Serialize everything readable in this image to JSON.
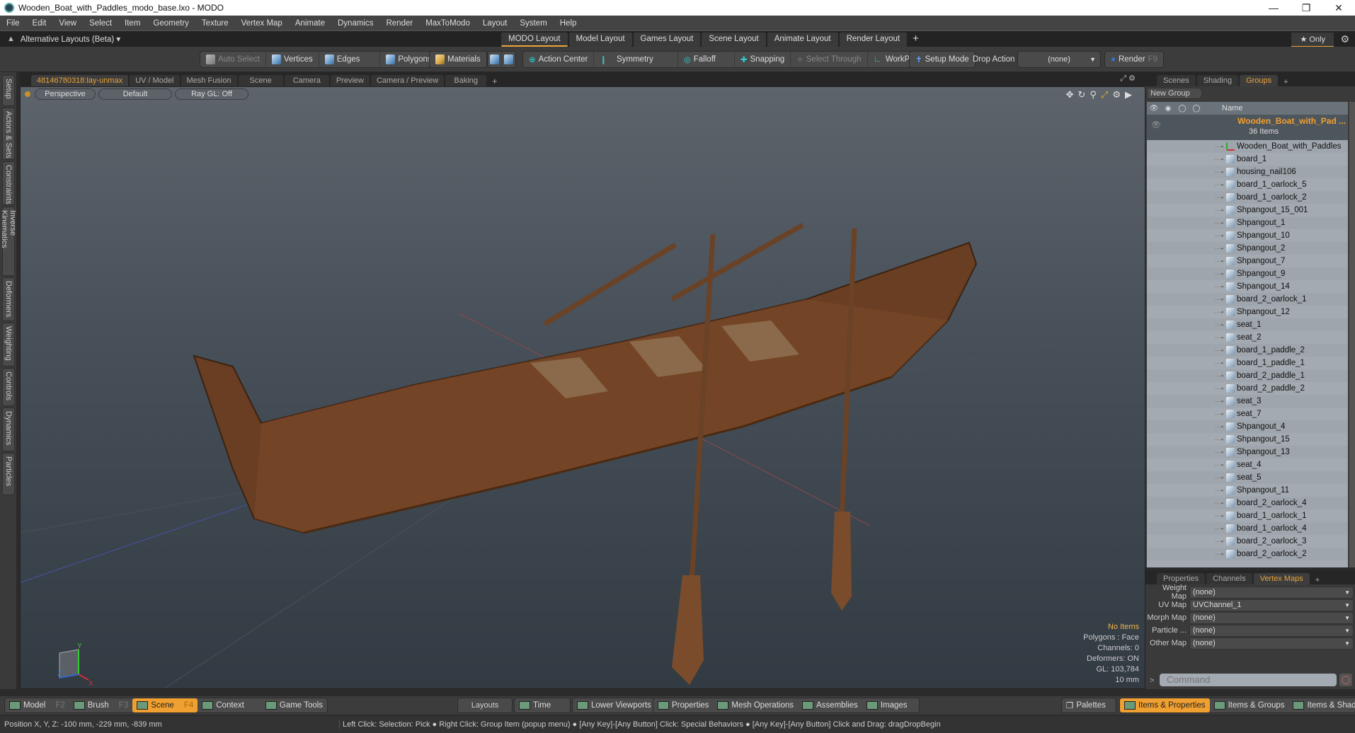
{
  "window": {
    "title": "Wooden_Boat_with_Paddles_modo_base.lxo - MODO",
    "controls": [
      "minimize",
      "restore",
      "close"
    ]
  },
  "menu": [
    "File",
    "Edit",
    "View",
    "Select",
    "Item",
    "Geometry",
    "Texture",
    "Vertex Map",
    "Animate",
    "Dynamics",
    "Render",
    "MaxToModo",
    "Layout",
    "System",
    "Help"
  ],
  "layoutbar": {
    "alt_layouts": "Alternative Layouts (Beta) ▾",
    "tabs": [
      "MODO Layout",
      "Model Layout",
      "Games Layout",
      "Scene Layout",
      "Animate Layout",
      "Render Layout"
    ],
    "active_tab": "MODO Layout",
    "add": "+",
    "only": "★  Only"
  },
  "toolbar": {
    "auto_select": "Auto Select",
    "vertices": "Vertices",
    "edges": "Edges",
    "polygons": "Polygons",
    "materials": "Materials",
    "action_center": "Action Center",
    "symmetry": "Symmetry",
    "falloff": "Falloff",
    "snapping": "Snapping",
    "select_through": "Select Through",
    "workplane": "WorkPlane",
    "setup_mode": "Setup Mode",
    "drop_action_label": "Drop Action",
    "drop_action_value": "(none)",
    "render": "Render",
    "render_key": "F9"
  },
  "left_tabs": [
    "Setup",
    "Actors & Sets",
    "Constraints",
    "Inverse Kinematics",
    "Deformers",
    "Weighting",
    "Controls",
    "Dynamics",
    "Particles"
  ],
  "viewport_tabs": [
    "48146780318:lay-unmax",
    "UV / Model",
    "Mesh Fusion",
    "Scene",
    "Camera",
    "Preview",
    "Camera / Preview",
    "Baking"
  ],
  "viewport": {
    "view": "Perspective",
    "shading": "Default",
    "raygl": "Ray GL: Off",
    "info": {
      "items": "No Items",
      "polygons": "Polygons : Face",
      "channels": "Channels: 0",
      "deformers": "Deformers: ON",
      "gl": "GL: 103,784",
      "scale": "10 mm"
    },
    "axes": {
      "x": "X",
      "y": "Y",
      "z": "Z"
    }
  },
  "scene_panel": {
    "tabs": [
      "Scenes",
      "Shading",
      "Groups"
    ],
    "active_tab": "Groups",
    "new_group": "New Group",
    "column_name": "Name",
    "group_name": "Wooden_Boat_with_Pad ...",
    "group_count": "36 Items",
    "items": [
      "Wooden_Boat_with_Paddles",
      "board_1",
      "housing_nail106",
      "board_1_oarlock_5",
      "board_1_oarlock_2",
      "Shpangout_15_001",
      "Shpangout_1",
      "Shpangout_10",
      "Shpangout_2",
      "Shpangout_7",
      "Shpangout_9",
      "Shpangout_14",
      "board_2_oarlock_1",
      "Shpangout_12",
      "seat_1",
      "seat_2",
      "board_1_paddle_2",
      "board_1_paddle_1",
      "board_2_paddle_1",
      "board_2_paddle_2",
      "seat_3",
      "seat_7",
      "Shpangout_4",
      "Shpangout_15",
      "Shpangout_13",
      "seat_4",
      "seat_5",
      "Shpangout_11",
      "board_2_oarlock_4",
      "board_1_oarlock_1",
      "board_1_oarlock_4",
      "board_2_oarlock_3",
      "board_2_oarlock_2"
    ]
  },
  "props_panel": {
    "tabs": [
      "Properties",
      "Channels",
      "Vertex Maps"
    ],
    "active_tab": "Vertex Maps",
    "rows": [
      {
        "label": "Weight Map",
        "value": "(none)"
      },
      {
        "label": "UV Map",
        "value": "UVChannel_1"
      },
      {
        "label": "Morph Map",
        "value": "(none)"
      },
      {
        "label": "Particle  ...",
        "value": "(none)"
      },
      {
        "label": "Other Map",
        "value": "(none)"
      }
    ],
    "command_placeholder": "Command"
  },
  "bottombar": {
    "modes": [
      {
        "label": "Model",
        "key": "F2"
      },
      {
        "label": "Brush",
        "key": "F3"
      },
      {
        "label": "Scene",
        "key": "F4"
      },
      {
        "label": "Context",
        "key": ""
      },
      {
        "label": "Game Tools",
        "key": ""
      }
    ],
    "active_mode": "Scene",
    "center": [
      "Layouts",
      "Time",
      "Lower Viewports",
      "Properties",
      "Mesh Operations",
      "Assemblies",
      "Images"
    ],
    "right": [
      "Palettes",
      "Items & Properties",
      "Items & Groups",
      "Items & Shading"
    ],
    "active_right": "Items & Properties"
  },
  "status": {
    "position": "Position X, Y, Z:   -100 mm, -229 mm, -839 mm",
    "hints": "Left Click: Selection: Pick ● Right Click: Group Item (popup menu) ● [Any Key]-[Any Button] Click: Special Behaviors ● [Any Key]-[Any Button] Click and Drag: dragDropBegin"
  }
}
